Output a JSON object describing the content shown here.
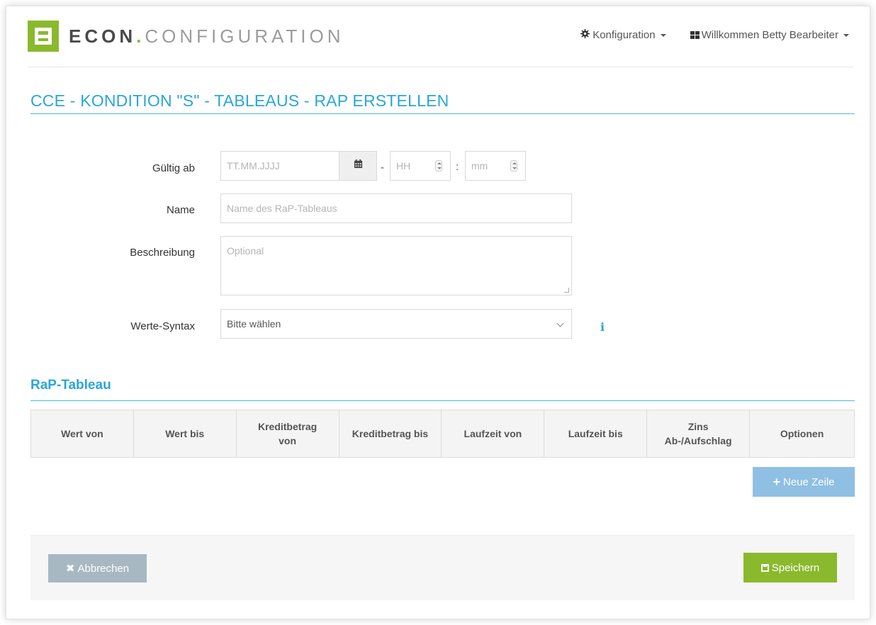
{
  "colors": {
    "accent": "#2aa6d9",
    "brand_green": "#8ab92d",
    "button_blue": "#8fbfe3",
    "button_grey": "#a7b8c3"
  },
  "header": {
    "logo_econ": "ECON",
    "logo_dot": ".",
    "logo_config": "CONFIGURATION",
    "nav_config_icon": "gear-icon",
    "nav_config_label": "Konfiguration",
    "nav_user_icon": "grid-icon",
    "nav_user_label": "Willkommen Betty Bearbeiter"
  },
  "page": {
    "title": "CCE - KONDITION \"S\" - TABLEAUS - RAP ERSTELLEN"
  },
  "form": {
    "valid_from": {
      "label": "Gültig ab",
      "date_placeholder": "TT.MM.JJJJ",
      "calendar_icon": "calendar-icon",
      "dash": "-",
      "hour_placeholder": "HH",
      "colon": ":",
      "minute_placeholder": "mm"
    },
    "name": {
      "label": "Name",
      "placeholder": "Name des RaP-Tableaus"
    },
    "description": {
      "label": "Beschreibung",
      "placeholder": "Optional"
    },
    "syntax": {
      "label": "Werte-Syntax",
      "selected": "Bitte wählen",
      "info_icon": "info-icon",
      "info_glyph": "i"
    }
  },
  "rap": {
    "section_title": "RaP-Tableau",
    "columns": [
      [
        "Wert von"
      ],
      [
        "Wert bis"
      ],
      [
        "Kreditbetrag",
        "von"
      ],
      [
        "Kreditbetrag bis"
      ],
      [
        "Laufzeit von"
      ],
      [
        "Laufzeit bis"
      ],
      [
        "Zins",
        "Ab-/Aufschlag"
      ],
      [
        "Optionen"
      ]
    ],
    "new_row_label": "Neue Zeile",
    "new_row_icon": "plus-icon",
    "new_row_glyph": "+"
  },
  "footer": {
    "cancel_label": "Abbrechen",
    "cancel_icon": "close-icon",
    "cancel_glyph": "✖",
    "save_label": "Speichern",
    "save_icon": "save-icon"
  }
}
